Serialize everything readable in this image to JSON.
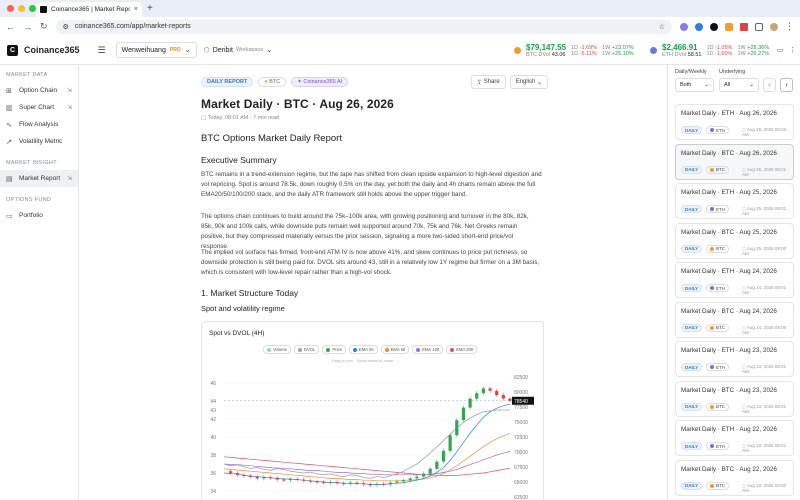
{
  "browser": {
    "tab_title": "Coinance365 | Market Report",
    "url": "coinance365.com/app/market-reports"
  },
  "header": {
    "brand": "Coinance365",
    "workspace": "Wenweihuang",
    "pro": "PRO",
    "exchange": "Deribit",
    "exchange_sub": "Workspace",
    "btc": {
      "price": "$79,147.55",
      "d_label": "1D",
      "d_val": "-1.69%",
      "w_label": "1W",
      "w_val": "+23.07%",
      "iv_label": "BTC DVol",
      "iv": "43.06",
      "d2_label": "1D",
      "d2_val": "-5.11%",
      "w2_label": "1W",
      "w2_val": "+25.10%"
    },
    "eth": {
      "price": "$2,466.91",
      "d_label": "1D",
      "d_val": "-1.05%",
      "w_label": "1W",
      "w_val": "+28.36%",
      "iv_label": "ETH DVol",
      "iv": "58.51",
      "d2_label": "1D",
      "d2_val": "-1.60%",
      "w2_label": "1W",
      "w2_val": "+26.27%"
    }
  },
  "sidebar": {
    "section1": "MARKET DATA",
    "items1": [
      {
        "label": "Option Chain"
      },
      {
        "label": "Super Chart"
      },
      {
        "label": "Flow Analysis"
      },
      {
        "label": "Volatility Metric"
      }
    ],
    "section2": "MARKET INSIGHT",
    "items2": [
      {
        "label": "Market Report"
      }
    ],
    "section3": "OPTIONS FUND",
    "items3": [
      {
        "label": "Portfolio"
      }
    ]
  },
  "report": {
    "badge_daily": "DAILY REPORT",
    "badge_coin": "BTC",
    "badge_ai": "Coinance365 AI",
    "share": "Share",
    "lang": "English",
    "title": "Market Daily · BTC · Aug 26, 2026",
    "meta": "Today, 08:01 AM  ·  7 min read",
    "h_main": "BTC Options Market Daily Report",
    "h_exec": "Executive Summary",
    "p1": "BTC remains in a trend-extension regime, but the tape has shifted from clean upside expansion to high-level digestion and vol repricing. Spot is around 78.5k, down roughly 0.5% on the day, yet both the daily and 4h charts remain above the full EMA20/50/100/200 stack, and the daily ATR framework still holds above the upper trigger band.",
    "p2": "The options chain continues to build around the 75k–100k area, with growing positioning and turnover in the 80k, 82k, 85k, 90k and 100k calls, while downside puts remain well supported around 70k, 75k and 76k. Net Greeks remain positive, but they compressed materially versus the prior session, signaling a more two-sided short-end price/vol response.",
    "p3": "The implied vol surface has firmed, front-end ATM IV is now above 41%, and skew continues to price put richness, so downside protection is still being paid for. DVOL sits around 43, still in a relatively low 1Y regime but firmer on a 3M basis, which is consistent with low-level repair rather than a high-vol shock.",
    "h_struct": "1. Market Structure Today",
    "h_spot": "Spot and volatility regime"
  },
  "chart_data": {
    "type": "line",
    "title": "Spot vs DVOL (4H)",
    "hint": "Drag to pan · Scroll wheel to zoom · ...",
    "legend": [
      "Volume",
      "DVOL",
      "Price",
      "EMA 20",
      "EMA 50",
      "EMA 100",
      "EMA 200"
    ],
    "legend_colors": [
      "#9fd8a8",
      "#9aa4b1",
      "#2fa84f",
      "#2f7fd8",
      "#f08a3c",
      "#9b6fd8",
      "#e04e6b"
    ],
    "y_left_ticks": [
      "46",
      "44",
      "43",
      "42",
      "40",
      "38",
      "36",
      "34"
    ],
    "y_left_range": [
      33,
      47
    ],
    "y_right_ticks": [
      "82500",
      "80000",
      "78540",
      "77500",
      "75000",
      "72500",
      "70000",
      "67500",
      "65000",
      "62500"
    ],
    "y_right_range": [
      62000,
      83000
    ],
    "current_price": "78540",
    "current_dvol": "43",
    "price": [
      66800,
      66500,
      66200,
      66000,
      65900,
      65600,
      65800,
      65700,
      65400,
      65300,
      65500,
      65400,
      65200,
      65100,
      65000,
      64900,
      65000,
      64800,
      64700,
      64900,
      64800,
      64600,
      64500,
      64700,
      64600,
      64900,
      65100,
      65300,
      65600,
      65900,
      66400,
      67200,
      68400,
      70200,
      72800,
      75300,
      77400,
      78900,
      79800,
      80600,
      80200,
      79500,
      78900,
      78540
    ],
    "dvol": [
      37.0,
      36.8,
      36.9,
      36.7,
      36.5,
      36.6,
      36.4,
      36.3,
      36.5,
      36.4,
      36.2,
      36.1,
      36.0,
      36.1,
      35.9,
      35.8,
      35.9,
      35.7,
      35.6,
      35.8,
      35.7,
      35.5,
      35.4,
      35.6,
      35.5,
      35.7,
      35.9,
      36.2,
      36.6,
      37.0,
      37.6,
      38.2,
      38.9,
      39.6,
      40.3,
      41.0,
      41.6,
      42.1,
      42.5,
      42.8,
      42.9,
      43.0,
      43.0,
      43.0
    ],
    "ema20": [
      66500,
      66400,
      66300,
      66100,
      66000,
      65900,
      65800,
      65700,
      65600,
      65500,
      65500,
      65400,
      65300,
      65200,
      65100,
      65000,
      64900,
      64900,
      64800,
      64800,
      64700,
      64700,
      64600,
      64600,
      64600,
      64700,
      64800,
      64900,
      65100,
      65300,
      65600,
      66000,
      66600,
      67400,
      68600,
      70000,
      71600,
      73100,
      74500,
      75800,
      76700,
      77300,
      77700,
      78000
    ],
    "ema50": [
      67200,
      67100,
      67000,
      66900,
      66800,
      66700,
      66600,
      66500,
      66400,
      66300,
      66200,
      66100,
      66000,
      65900,
      65800,
      65700,
      65600,
      65600,
      65500,
      65400,
      65400,
      65300,
      65300,
      65200,
      65200,
      65200,
      65200,
      65300,
      65300,
      65400,
      65500,
      65700,
      66000,
      66400,
      67000,
      67700,
      68500,
      69300,
      70100,
      70900,
      71600,
      72200,
      72700,
      73100
    ],
    "ema100": [
      68000,
      67900,
      67900,
      67800,
      67700,
      67600,
      67500,
      67400,
      67300,
      67300,
      67200,
      67100,
      67000,
      66900,
      66900,
      66800,
      66700,
      66600,
      66600,
      66500,
      66400,
      66400,
      66300,
      66300,
      66200,
      66200,
      66200,
      66200,
      66200,
      66200,
      66200,
      66300,
      66400,
      66600,
      66800,
      67100,
      67500,
      67900,
      68300,
      68700,
      69100,
      69500,
      69800,
      70100
    ],
    "ema200": [
      69200,
      69100,
      69000,
      68900,
      68800,
      68700,
      68600,
      68500,
      68400,
      68300,
      68200,
      68100,
      68000,
      67900,
      67800,
      67700,
      67600,
      67500,
      67400,
      67300,
      67200,
      67100,
      67000,
      66900,
      66800,
      66700,
      66600,
      66500,
      66400,
      66300,
      66200,
      66200,
      66100,
      66100,
      66100,
      66100,
      66200,
      66300,
      66400,
      66500,
      66700,
      66900,
      67100,
      67300
    ]
  },
  "panel": {
    "filter1": "Daily/Weekly",
    "filter2": "Underlying",
    "sel1": "Both",
    "sel2": "All",
    "cards": [
      {
        "title": "Market Daily · ETH · Aug 26, 2026",
        "tag": "DAILY",
        "coin": "ETH",
        "coin_color": "#6b7bd6",
        "date": "Aug 26, 2026 08:03 AM"
      },
      {
        "title": "Market Daily · BTC · Aug 26, 2026",
        "tag": "DAILY",
        "coin": "BTC",
        "coin_color": "#f39a2b",
        "date": "Aug 26, 2026 08:01 AM"
      },
      {
        "title": "Market Daily · ETH · Aug 25, 2026",
        "tag": "DAILY",
        "coin": "ETH",
        "coin_color": "#6b7bd6",
        "date": "Aug 25, 2026 08:01 AM"
      },
      {
        "title": "Market Daily · BTC · Aug 25, 2026",
        "tag": "DAILY",
        "coin": "BTC",
        "coin_color": "#f39a2b",
        "date": "Aug 25, 2026 08:00 AM"
      },
      {
        "title": "Market Daily · ETH · Aug 24, 2026",
        "tag": "DAILY",
        "coin": "ETH",
        "coin_color": "#6b7bd6",
        "date": "Aug 24, 2026 08:01 AM"
      },
      {
        "title": "Market Daily · BTC · Aug 24, 2026",
        "tag": "DAILY",
        "coin": "BTC",
        "coin_color": "#f39a2b",
        "date": "Aug 24, 2026 08:00 AM"
      },
      {
        "title": "Market Daily · ETH · Aug 23, 2026",
        "tag": "DAILY",
        "coin": "ETH",
        "coin_color": "#6b7bd6",
        "date": "Aug 23, 2026 08:01 AM"
      },
      {
        "title": "Market Daily · BTC · Aug 23, 2026",
        "tag": "DAILY",
        "coin": "BTC",
        "coin_color": "#f39a2b",
        "date": "Aug 23, 2026 08:01 AM"
      },
      {
        "title": "Market Daily · ETH · Aug 22, 2026",
        "tag": "DAILY",
        "coin": "ETH",
        "coin_color": "#6b7bd6",
        "date": "Aug 22, 2026 08:01 AM"
      },
      {
        "title": "Market Daily · BTC · Aug 22, 2026",
        "tag": "DAILY",
        "coin": "BTC",
        "coin_color": "#f39a2b",
        "date": "Aug 22, 2026 08:00 AM"
      }
    ]
  }
}
